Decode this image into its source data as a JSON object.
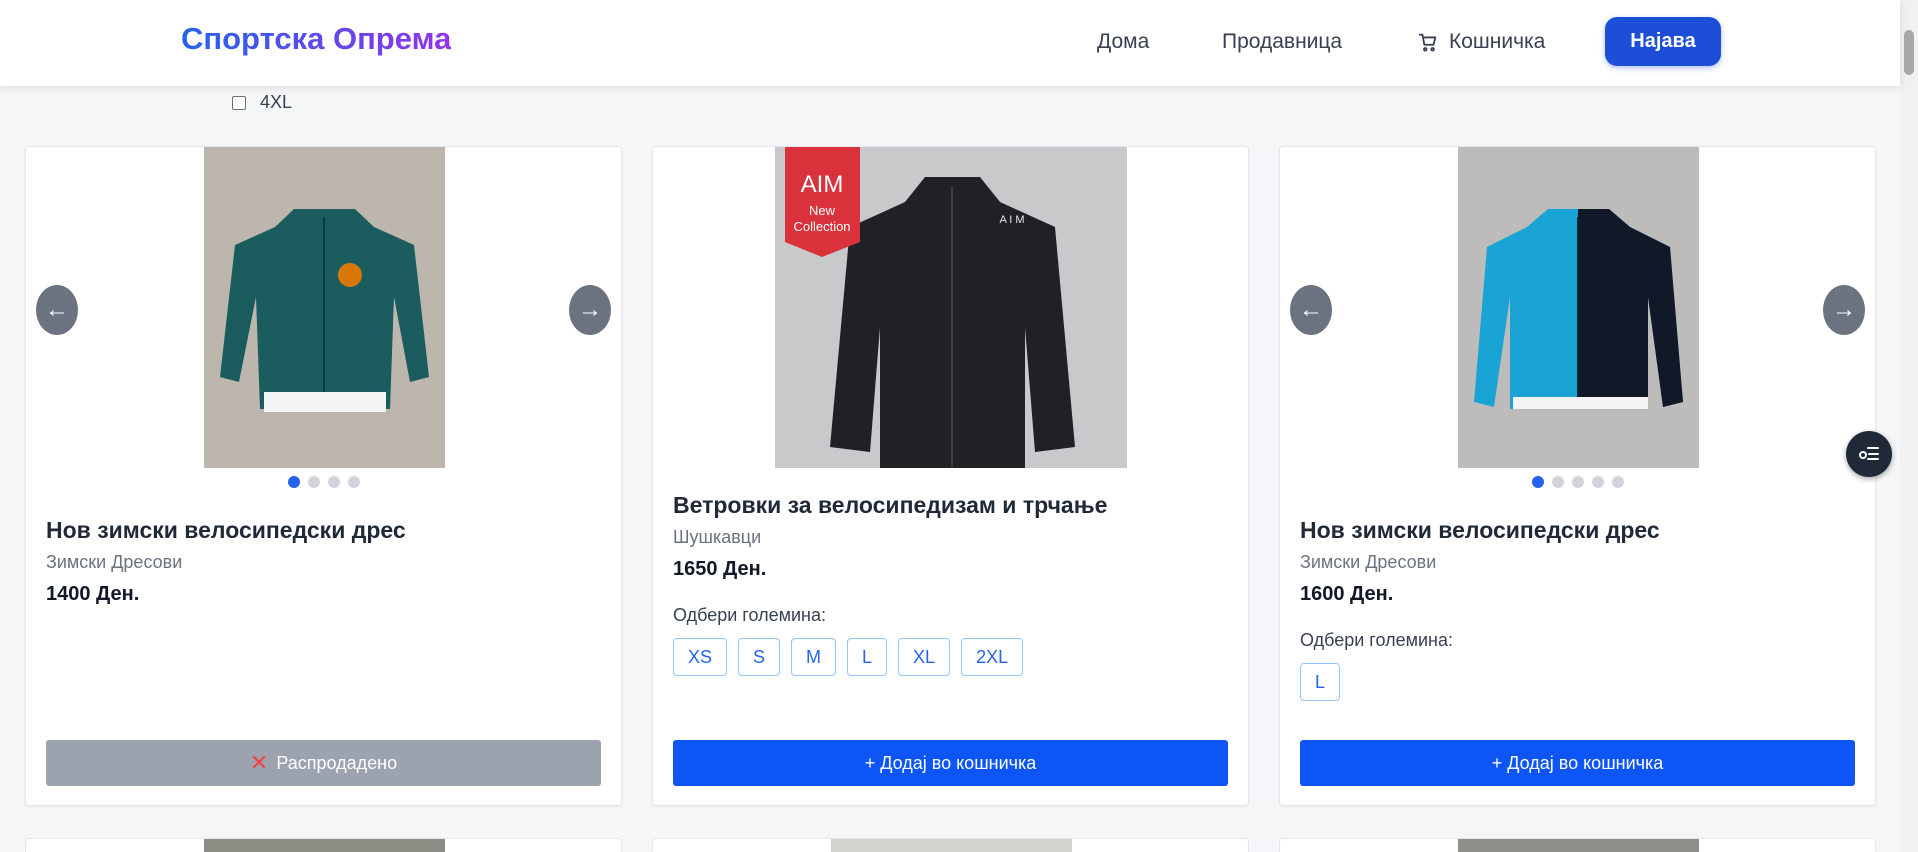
{
  "brand": "Спортска Опрема",
  "nav": {
    "home": "Дома",
    "shop": "Продавница",
    "cart": "Кошничка",
    "login": "Најава"
  },
  "filter": {
    "option_label": "4XL"
  },
  "products": [
    {
      "title": "Нов зимски велосипедски дрес",
      "category": "Зимски Дресови",
      "price": "1400 Ден.",
      "button": "Распродадено",
      "photo_color": "#1b5c5e",
      "image_count": 4
    },
    {
      "title": "Ветровки за велосипедизам и трчање",
      "category": "Шушкавци",
      "price": "1650 Ден.",
      "size_label": "Одбери големина:",
      "sizes": [
        "XS",
        "S",
        "M",
        "L",
        "XL",
        "2XL"
      ],
      "button": "+ Додај во кошничка",
      "photo_badge": [
        "AIM",
        "New",
        "Collection"
      ],
      "photo_logo": "A I M"
    },
    {
      "title": "Нов зимски велосипедски дрес",
      "category": "Зимски Дресови",
      "price": "1600 Ден.",
      "size_label": "Одбери големина:",
      "sizes": [
        "L"
      ],
      "button": "+ Додај во кошничка",
      "photo_color": "#1aa4d6",
      "image_count": 5
    }
  ],
  "arrows": {
    "left": "←",
    "right": "→"
  },
  "colors": {
    "primary": "#0d55f5",
    "sold": "#9ca3af",
    "brand_from": "#2563eb",
    "brand_to": "#9333ea"
  }
}
